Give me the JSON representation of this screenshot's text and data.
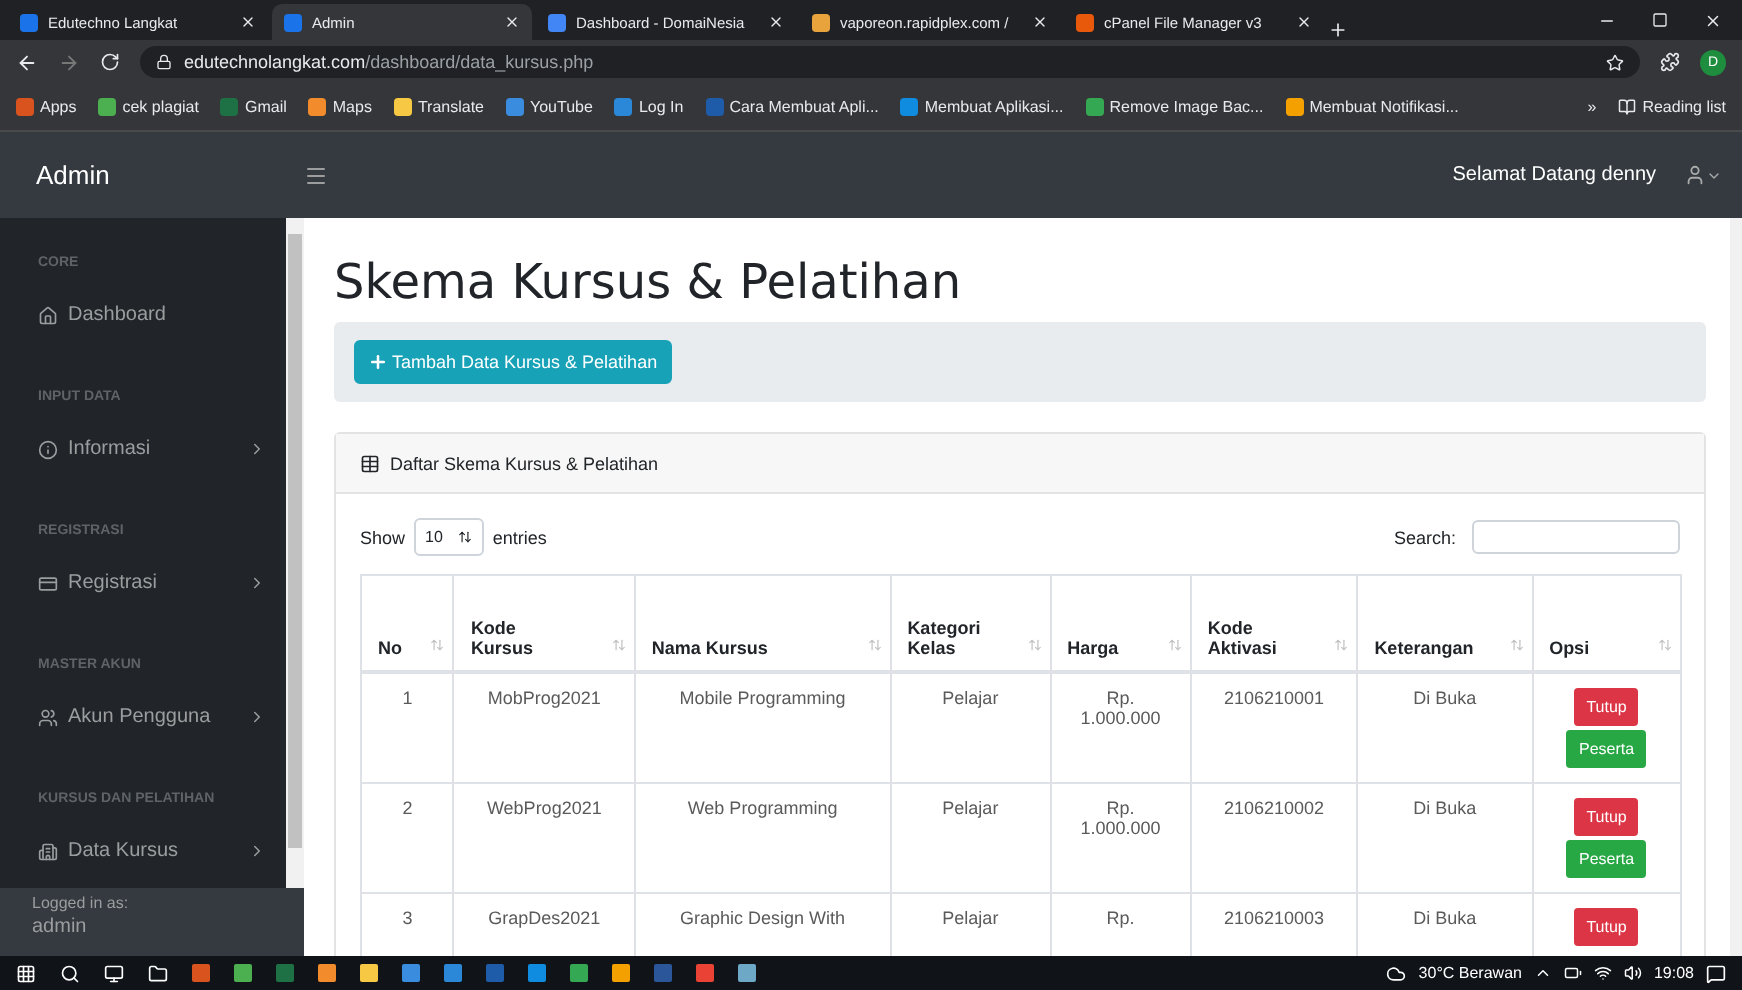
{
  "browser": {
    "tabs": [
      {
        "title": "Edutechno Langkat",
        "selected": false
      },
      {
        "title": "Admin",
        "selected": true
      },
      {
        "title": "Dashboard - DomaiNesia",
        "selected": false
      },
      {
        "title": "vaporeon.rapidplex.com /",
        "selected": false
      },
      {
        "title": "cPanel File Manager v3",
        "selected": false
      }
    ],
    "address": {
      "host": "edutechnolangkat.com",
      "path": "/dashboard/data_kursus.php"
    },
    "profile_initial": "D",
    "bookmarks": [
      "Apps",
      "cek plagiat",
      "Gmail",
      "Maps",
      "Translate",
      "YouTube",
      "Log In",
      "Cara Membuat Apli...",
      "Membuat Aplikasi...",
      "Remove Image Bac...",
      "Membuat Notifikasi..."
    ],
    "overflow": "»",
    "reading_list": "Reading list"
  },
  "navbar": {
    "brand": "Admin",
    "greeting": "Selamat Datang denny"
  },
  "sidebar": {
    "sections": [
      {
        "heading": "CORE",
        "items": [
          {
            "label": "Dashboard",
            "kind": "link"
          }
        ]
      },
      {
        "heading": "INPUT DATA",
        "items": [
          {
            "label": "Informasi",
            "kind": "collapse"
          }
        ]
      },
      {
        "heading": "REGISTRASI",
        "items": [
          {
            "label": "Registrasi",
            "kind": "collapse"
          }
        ]
      },
      {
        "heading": "MASTER AKUN",
        "items": [
          {
            "label": "Akun Pengguna",
            "kind": "collapse"
          }
        ]
      },
      {
        "heading": "KURSUS DAN PELATIHAN",
        "items": [
          {
            "label": "Data Kursus",
            "kind": "collapse"
          }
        ]
      }
    ],
    "footer": {
      "label": "Logged in as:",
      "user": "admin"
    }
  },
  "page": {
    "title": "Skema Kursus & Pelatihan",
    "add_button": "Tambah Data Kursus & Pelatihan",
    "card_title": "Daftar Skema Kursus & Pelatihan",
    "length": {
      "before": "Show",
      "value": "10",
      "after": "entries"
    },
    "search_label": "Search:",
    "table": {
      "columns": [
        [
          "No"
        ],
        [
          "Kode",
          "Kursus"
        ],
        [
          "Nama Kursus"
        ],
        [
          "Kategori",
          "Kelas"
        ],
        [
          "Harga"
        ],
        [
          "Kode",
          "Aktivasi"
        ],
        [
          "Keterangan"
        ],
        [
          "Opsi"
        ]
      ],
      "rows": [
        {
          "no": "1",
          "kode": "MobProg2021",
          "nama": "Mobile Programming",
          "kategori": "Pelajar",
          "harga": [
            "Rp.",
            "1.000.000"
          ],
          "aktivasi": "2106210001",
          "keterangan": "Di Buka",
          "buttons": [
            "Tutup",
            "Peserta"
          ]
        },
        {
          "no": "2",
          "kode": "WebProg2021",
          "nama": "Web Programming",
          "kategori": "Pelajar",
          "harga": [
            "Rp.",
            "1.000.000"
          ],
          "aktivasi": "2106210002",
          "keterangan": "Di Buka",
          "buttons": [
            "Tutup",
            "Peserta"
          ]
        },
        {
          "no": "3",
          "kode": "GrapDes2021",
          "nama": "Graphic Design With",
          "kategori": "Pelajar",
          "harga": [
            "Rp."
          ],
          "aktivasi": "2106210003",
          "keterangan": "Di Buka",
          "buttons": [
            "Tutup"
          ]
        }
      ]
    }
  },
  "taskbar": {
    "weather": "30°C Berawan",
    "time": "19:08"
  }
}
